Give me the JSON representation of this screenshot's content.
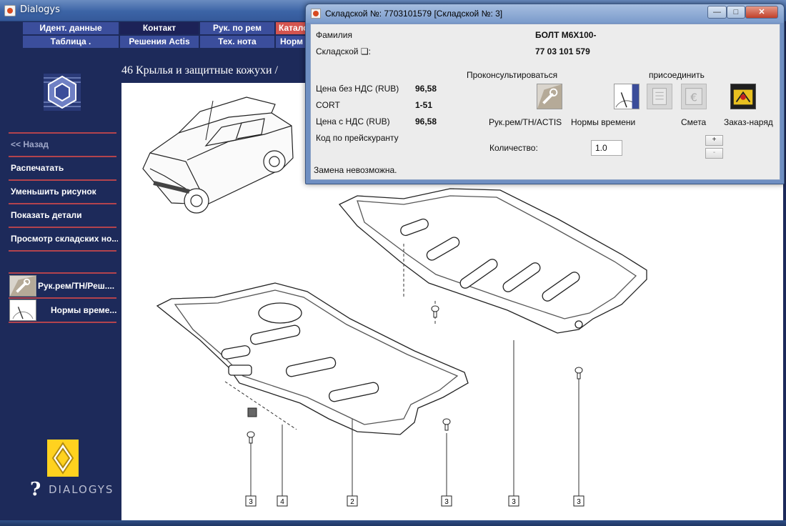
{
  "window": {
    "title": "Dialogys"
  },
  "tabs": {
    "row1": [
      "Идент. данные",
      "Контакт",
      "Рук. по рем",
      "Катало"
    ],
    "row2": [
      "Таблица .",
      "Решения Actis",
      "Тех. нота",
      "Норм"
    ]
  },
  "sidebar": {
    "back": "<< Назад",
    "items": [
      "Распечатать",
      "Уменьшить рисунок",
      "Показать детали",
      "Просмотр складских но..."
    ],
    "quick": [
      "Рук.рем/ТН/Реш....",
      "Нормы време..."
    ],
    "brand": "DIALOGYS",
    "help_mark": "?"
  },
  "content": {
    "section_title": "46 Крылья и защитные кожухи /",
    "callouts": [
      "3",
      "4",
      "2",
      "3",
      "3",
      "3"
    ]
  },
  "dialog": {
    "title": "Складской №: 7703101579 [Складской №: 3]",
    "buttons": {
      "minimize": "—",
      "maximize": "□",
      "close": "✕"
    },
    "family_label": "Фамилия",
    "family_value": "БОЛТ М6Х100-",
    "ref_label": "Складской ❏:",
    "ref_value": "77 03 101 579",
    "price_net_label": "Цена без НДС (RUB)",
    "price_net_value": "96,58",
    "cort_label": "CORT",
    "cort_value": "1-51",
    "price_gross_label": "Цена с НДС (RUB)",
    "price_gross_value": "96,58",
    "price_code_label": "Код по прейскуранту",
    "consult_heading": "Проконсультироваться",
    "attach_heading": "присоединить",
    "actions": [
      "Рук.рем/ТН/ACTIS",
      "Нормы времени",
      "Смета",
      "Заказ-наряд"
    ],
    "quantity_label": "Количество:",
    "quantity_value": "1.0",
    "plus": "+",
    "minus": "-",
    "replacement_note": "Замена невозможна."
  }
}
